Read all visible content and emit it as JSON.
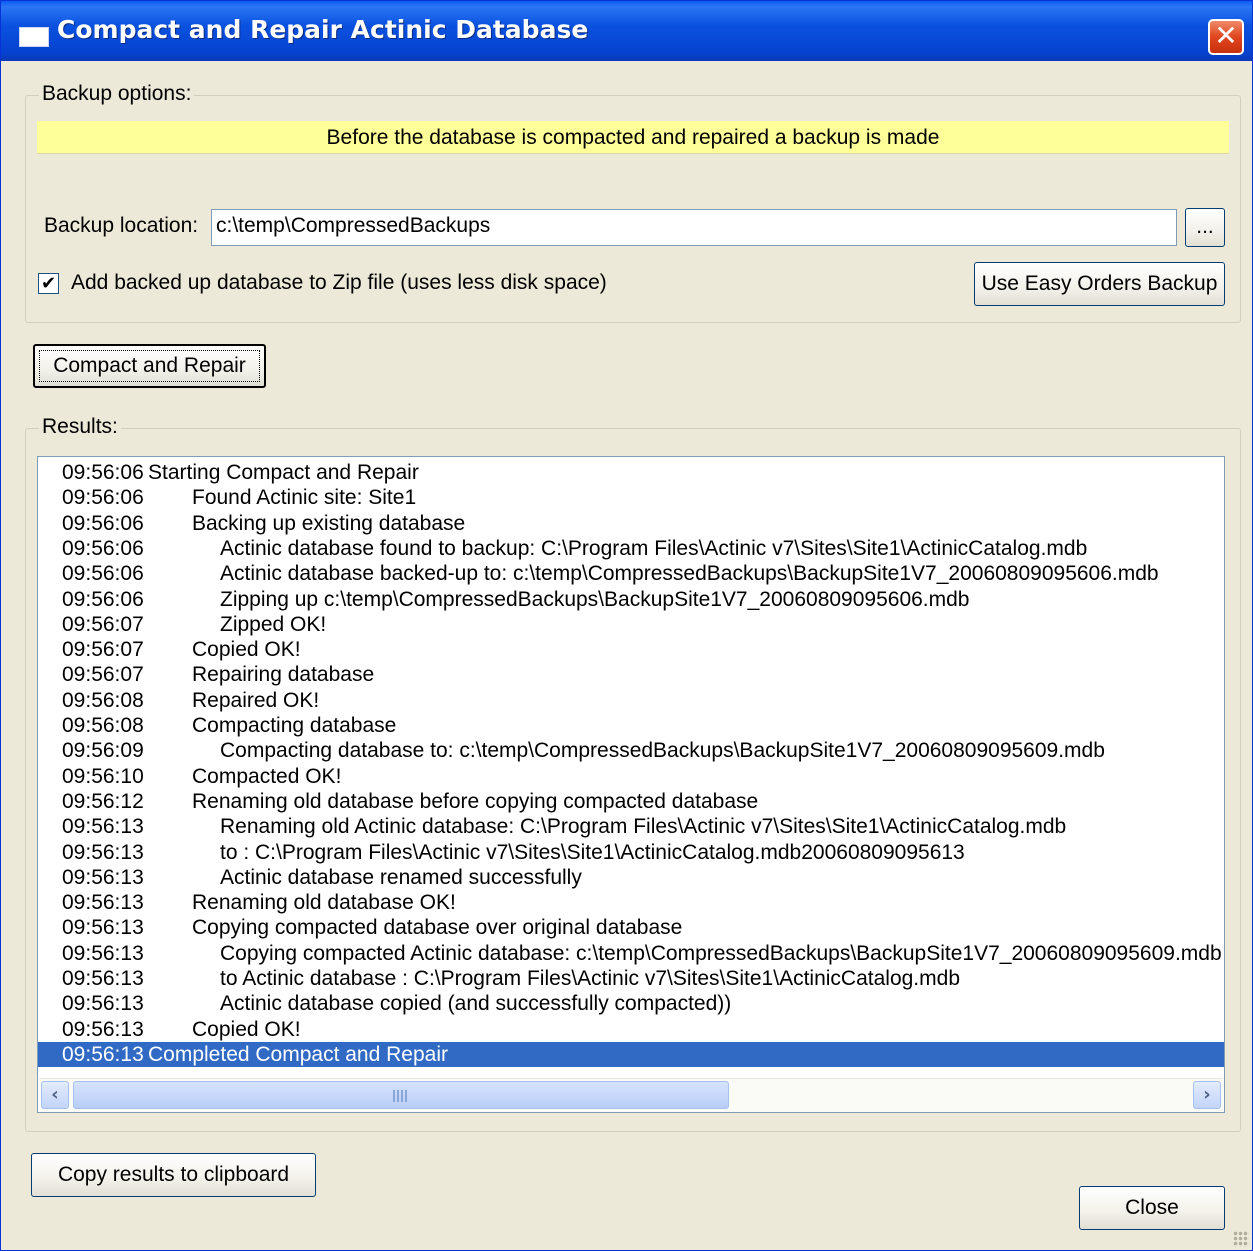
{
  "window": {
    "title": "Compact and Repair Actinic Database",
    "close_glyph": "✕"
  },
  "backup": {
    "group_label": "Backup options:",
    "info_text": "Before the database is compacted and repaired a backup is made",
    "location_label": "Backup location:",
    "location_value": "c:\\temp\\CompressedBackups",
    "browse_label": "...",
    "zip_checked": true,
    "zip_label": "Add backed up database to Zip file (uses less disk space)",
    "easy_orders_label": "Use Easy Orders Backup"
  },
  "actions": {
    "compact_label": "Compact and Repair"
  },
  "results": {
    "group_label": "Results:",
    "lines": [
      {
        "time": "09:56:06",
        "msg": "Starting Compact and Repair",
        "indent": 0
      },
      {
        "time": "09:56:06",
        "msg": "Found Actinic site: Site1",
        "indent": 1
      },
      {
        "time": "09:56:06",
        "msg": "Backing up existing database",
        "indent": 1
      },
      {
        "time": "09:56:06",
        "msg": "Actinic database found to backup: C:\\Program Files\\Actinic v7\\Sites\\Site1\\ActinicCatalog.mdb",
        "indent": 2
      },
      {
        "time": "09:56:06",
        "msg": "Actinic database backed-up to: c:\\temp\\CompressedBackups\\BackupSite1V7_20060809095606.mdb",
        "indent": 2
      },
      {
        "time": "09:56:06",
        "msg": "Zipping up c:\\temp\\CompressedBackups\\BackupSite1V7_20060809095606.mdb",
        "indent": 2
      },
      {
        "time": "09:56:07",
        "msg": "Zipped OK!",
        "indent": 2
      },
      {
        "time": "09:56:07",
        "msg": "Copied OK!",
        "indent": 1
      },
      {
        "time": "09:56:07",
        "msg": "Repairing database",
        "indent": 1
      },
      {
        "time": "09:56:08",
        "msg": "Repaired OK!",
        "indent": 1
      },
      {
        "time": "09:56:08",
        "msg": "Compacting database",
        "indent": 1
      },
      {
        "time": "09:56:09",
        "msg": "Compacting database to: c:\\temp\\CompressedBackups\\BackupSite1V7_20060809095609.mdb",
        "indent": 2
      },
      {
        "time": "09:56:10",
        "msg": "Compacted OK!",
        "indent": 1
      },
      {
        "time": "09:56:12",
        "msg": "Renaming old database before copying compacted database",
        "indent": 1
      },
      {
        "time": "09:56:13",
        "msg": "Renaming old Actinic database: C:\\Program Files\\Actinic v7\\Sites\\Site1\\ActinicCatalog.mdb",
        "indent": 2
      },
      {
        "time": "09:56:13",
        "msg": "to : C:\\Program Files\\Actinic v7\\Sites\\Site1\\ActinicCatalog.mdb20060809095613",
        "indent": 2
      },
      {
        "time": "09:56:13",
        "msg": "Actinic database renamed successfully",
        "indent": 2
      },
      {
        "time": "09:56:13",
        "msg": "Renaming old database OK!",
        "indent": 1
      },
      {
        "time": "09:56:13",
        "msg": "Copying compacted database over original database",
        "indent": 1
      },
      {
        "time": "09:56:13",
        "msg": "Copying compacted Actinic database: c:\\temp\\CompressedBackups\\BackupSite1V7_20060809095609.mdb",
        "indent": 2
      },
      {
        "time": "09:56:13",
        "msg": "to Actinic database : C:\\Program Files\\Actinic v7\\Sites\\Site1\\ActinicCatalog.mdb",
        "indent": 2
      },
      {
        "time": "09:56:13",
        "msg": "Actinic database copied (and successfully compacted))",
        "indent": 2
      },
      {
        "time": "09:56:13",
        "msg": "Copied OK!",
        "indent": 1
      },
      {
        "time": "09:56:13",
        "msg": "Completed Compact and Repair",
        "indent": 0,
        "selected": true
      }
    ]
  },
  "footer": {
    "copy_label": "Copy results to clipboard",
    "close_label": "Close"
  },
  "icons": {
    "scroll_left": "‹",
    "scroll_right": "›"
  },
  "colors": {
    "title_bar": "#0842d0",
    "info_bar": "#ffff99",
    "selection": "#316ac5",
    "dialog_bg": "#ece9d8"
  }
}
